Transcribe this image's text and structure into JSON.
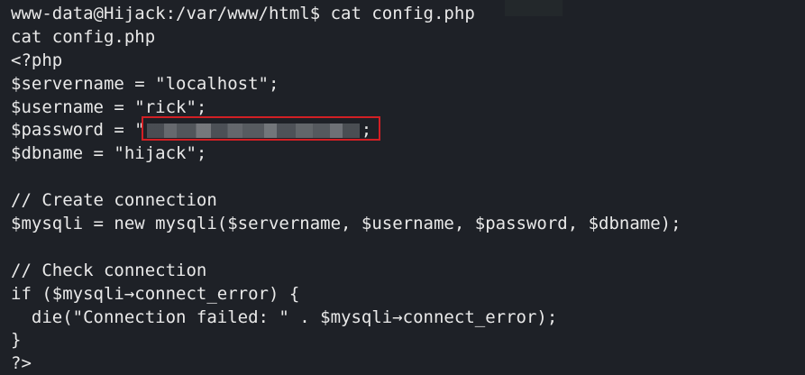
{
  "terminal": {
    "prompt": "www-data@Hijack:/var/www/html$ cat config.php",
    "lines": [
      "cat config.php",
      "<?php",
      "$servername = \"localhost\";",
      "$username = \"rick\";"
    ],
    "password_line": {
      "prefix": "$password = \"",
      "suffix": ";"
    },
    "lines_after": [
      "$dbname = \"hijack\";",
      "",
      "// Create connection",
      "$mysqli = new mysqli($servername, $username, $password, $dbname);",
      "",
      "// Check connection",
      "if ($mysqli→connect_error) {",
      "  die(\"Connection failed: \" . $mysqli→connect_error);",
      "}",
      "?>"
    ],
    "colors": {
      "background": "#1e2127",
      "text": "#e9e9e9",
      "highlight_box": "#d21f24"
    }
  }
}
